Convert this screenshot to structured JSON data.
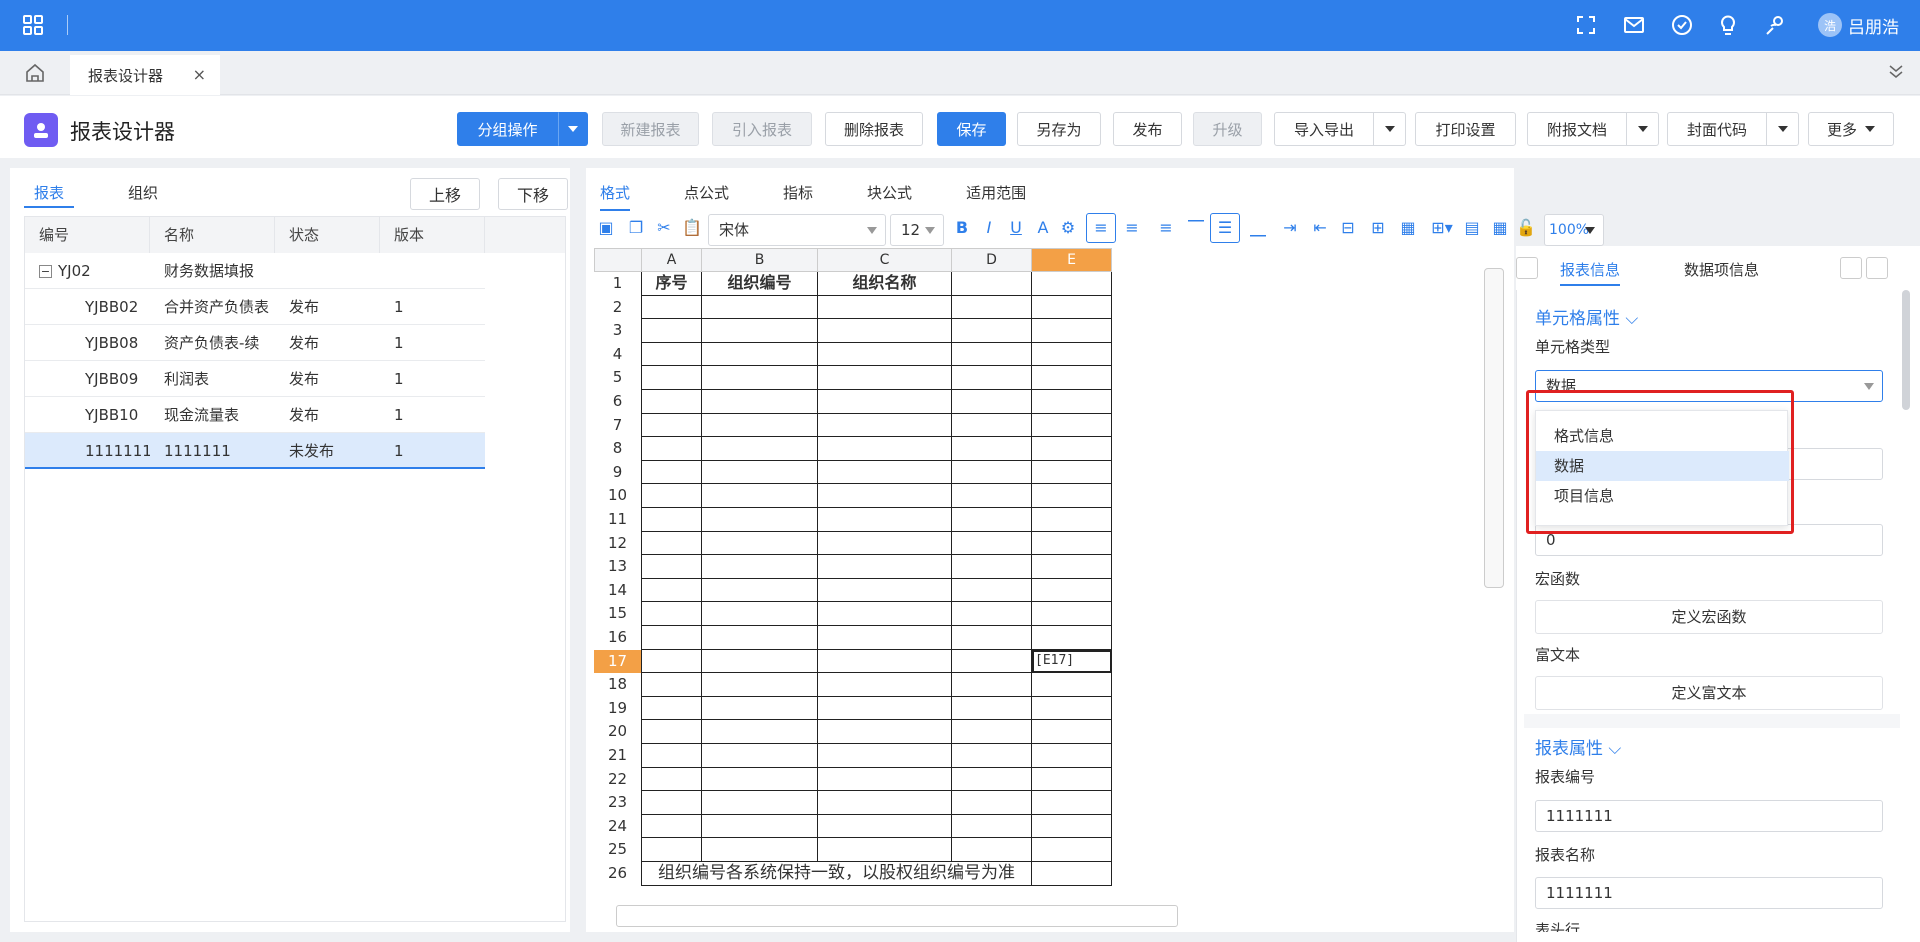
{
  "topbar": {
    "user_initial": "浩",
    "user_name": "吕朋浩"
  },
  "tabs": {
    "active_label": "报表设计器",
    "close": "×"
  },
  "header": {
    "title": "报表设计器",
    "buttons": {
      "group_ops": "分组操作",
      "new_report": "新建报表",
      "import_report": "引入报表",
      "delete_report": "删除报表",
      "save": "保存",
      "save_as": "另存为",
      "publish": "发布",
      "upgrade": "升级",
      "import_export": "导入导出",
      "print_settings": "打印设置",
      "attach_doc": "附报文档",
      "cover_code": "封面代码",
      "more": "更多"
    }
  },
  "left": {
    "tabs": [
      "报表",
      "组织"
    ],
    "up": "上移",
    "down": "下移",
    "columns": [
      "编号",
      "名称",
      "状态",
      "版本"
    ],
    "group": {
      "code": "YJ02",
      "name": "财务数据填报",
      "toggle": "−"
    },
    "rows": [
      {
        "code": "YJBB02",
        "name": "合并资产负债表",
        "status": "发布",
        "version": "1"
      },
      {
        "code": "YJBB08",
        "name": "资产负债表-续",
        "status": "发布",
        "version": "1"
      },
      {
        "code": "YJBB09",
        "name": "利润表",
        "status": "发布",
        "version": "1"
      },
      {
        "code": "YJBB10",
        "name": "现金流量表",
        "status": "发布",
        "version": "1"
      },
      {
        "code": "1111111",
        "name": "1111111",
        "status": "未发布",
        "version": "1"
      }
    ]
  },
  "middle": {
    "tabs": [
      "格式",
      "点公式",
      "指标",
      "块公式",
      "适用范围"
    ],
    "font": "宋体",
    "font_size": "12",
    "zoom": "100%",
    "bold": "B",
    "italic": "I",
    "underline": "U",
    "color": "A",
    "sheet": {
      "columns": [
        "A",
        "B",
        "C",
        "D",
        "E"
      ],
      "selected_col": "E",
      "selected_row": 17,
      "row_count": 26,
      "header_cells": [
        "序号",
        "组织编号",
        "组织名称"
      ],
      "selected_cell_text": "[E17]",
      "note_row_text": "组织编号各系统保持一致，以股权组织编号为准"
    }
  },
  "right": {
    "tab_info": "报表信息",
    "tab_data": "数据项信息",
    "cell_props": "单元格属性",
    "cell_type_label": "单元格类型",
    "cell_type_value": "数据",
    "dropdown": [
      "格式信息",
      "数据",
      "项目信息"
    ],
    "field_value": "0",
    "macro_label": "宏函数",
    "macro_btn": "定义宏函数",
    "rich_label": "富文本",
    "rich_btn": "定义富文本",
    "report_props": "报表属性",
    "report_code_label": "报表编号",
    "report_code": "1111111",
    "report_name_label": "报表名称",
    "report_name": "1111111",
    "cut_label": "表头行"
  }
}
